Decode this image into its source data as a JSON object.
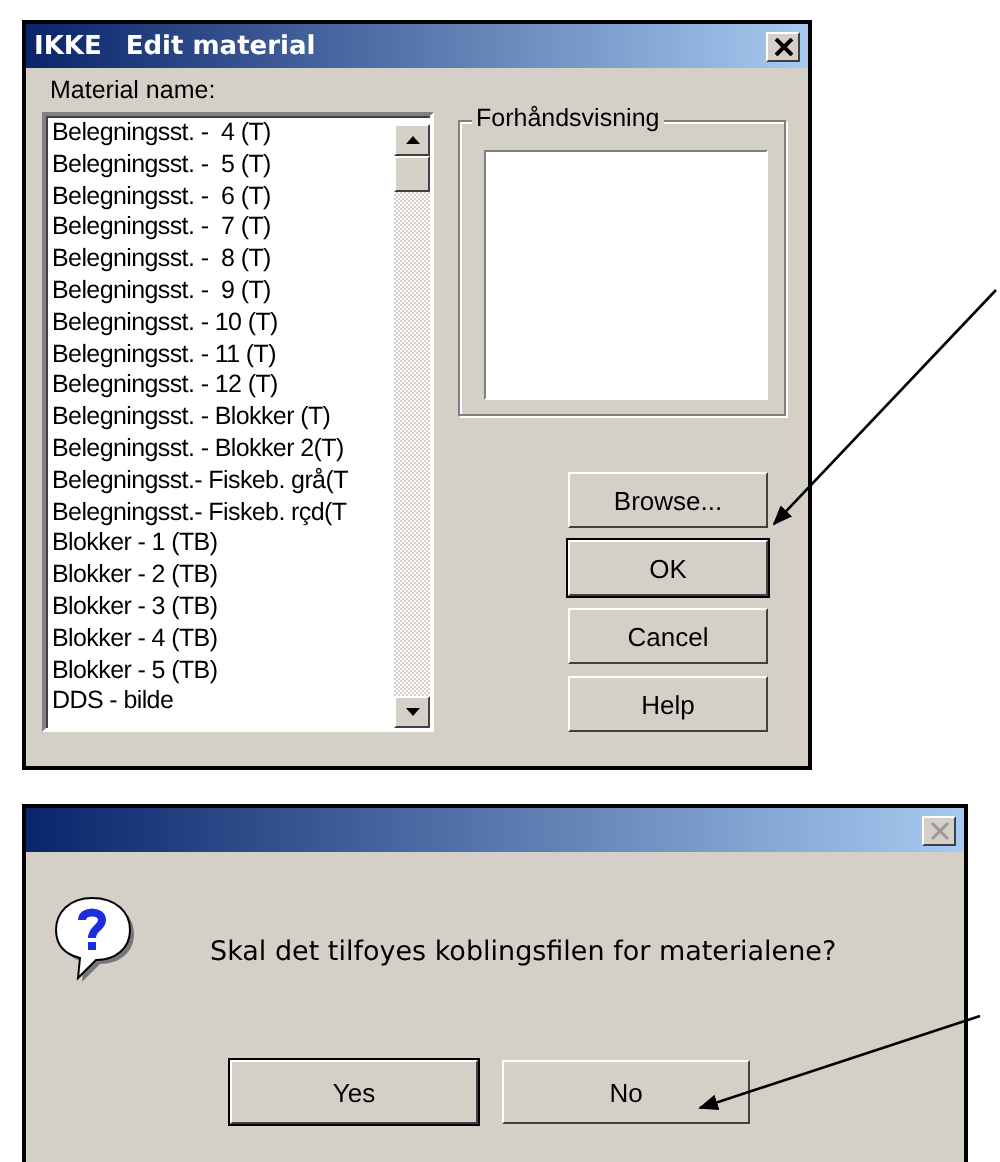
{
  "dialog": {
    "app": "IKKE",
    "title": "Edit material",
    "close_enabled": true,
    "label": "Material name:",
    "items": [
      "Belegningsst. -  4 (T)",
      "Belegningsst. -  5 (T)",
      "Belegningsst. -  6 (T)",
      "Belegningsst. -  7 (T)",
      "Belegningsst. -  8 (T)",
      "Belegningsst. -  9 (T)",
      "Belegningsst. - 10 (T)",
      "Belegningsst. - 11 (T)",
      "Belegningsst. - 12 (T)",
      "Belegningsst. - Blokker (T)",
      "Belegningsst. - Blokker 2(T)",
      "Belegningsst.- Fiskeb. grå(T",
      "Belegningsst.- Fiskeb. rçd(T",
      "Blokker - 1 (TB)",
      "Blokker - 2 (TB)",
      "Blokker - 3 (TB)",
      "Blokker - 4 (TB)",
      "Blokker - 5 (TB)",
      "DDS - bilde"
    ],
    "preview_label": "Forhåndsvisning",
    "buttons": [
      {
        "label": "Browse...",
        "default": false
      },
      {
        "label": "OK",
        "default": true
      },
      {
        "label": "Cancel",
        "default": false
      },
      {
        "label": "Help",
        "default": false
      }
    ]
  },
  "prompt": {
    "close_enabled": false,
    "message": "Skal det tilfoyes koblingsfilen for materialene?",
    "buttons": [
      {
        "label": "Yes",
        "default": true
      },
      {
        "label": "No",
        "default": false
      }
    ]
  }
}
